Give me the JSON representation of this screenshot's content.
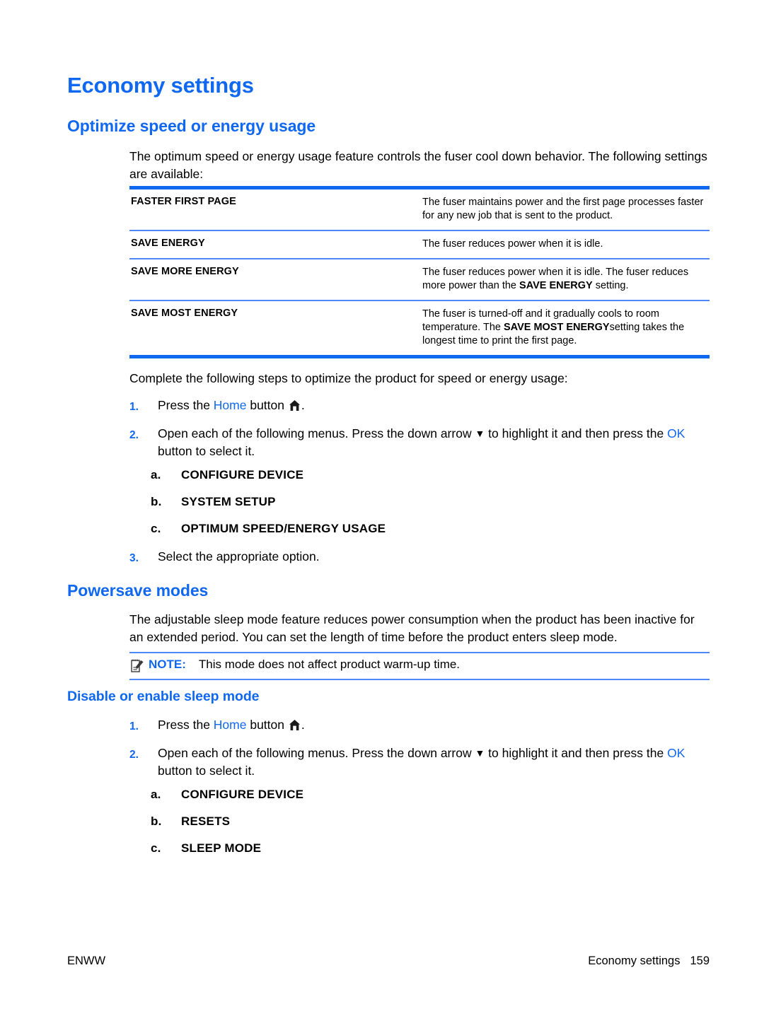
{
  "colors": {
    "accent_blue": "#1068f0",
    "rule_light_blue": "#4d86f7",
    "text": "#000000"
  },
  "page": {
    "title": "Economy settings",
    "sections": {
      "optimize": {
        "heading": "Optimize speed or energy usage",
        "intro": "The optimum speed or energy usage feature controls the fuser cool down behavior. The following settings are available:",
        "table": {
          "rows": [
            {
              "term": "FASTER FIRST PAGE",
              "desc": "The fuser maintains power and the first page processes faster for any new job that is sent to the product."
            },
            {
              "term": "SAVE ENERGY",
              "desc": "The fuser reduces power when it is idle."
            },
            {
              "term": "SAVE MORE ENERGY",
              "desc_pre": "The fuser reduces power when it is idle. The fuser reduces more power than the ",
              "desc_bold": "SAVE ENERGY",
              "desc_post": " setting."
            },
            {
              "term": "SAVE MOST ENERGY",
              "desc_pre": "The fuser is turned-off and it gradually cools to room temperature. The ",
              "desc_bold": "SAVE MOST ENERGY",
              "desc_post": "setting takes the longest time to print the first page."
            }
          ]
        },
        "complete_intro": "Complete the following steps to optimize the product for speed or energy usage:",
        "steps": {
          "s1_num": "1.",
          "s1_pre": "Press the ",
          "s1_link": "Home",
          "s1_mid": " button ",
          "s1_post": ".",
          "s2_num": "2.",
          "s2_pre": "Open each of the following menus. Press the down arrow ",
          "s2_arrow": "▼",
          "s2_mid": " to highlight it and then press the ",
          "s2_link": "OK",
          "s2_post": " button to select it.",
          "s3_num": "3.",
          "s3_text": "Select the appropriate option.",
          "sub": [
            {
              "letter": "a.",
              "label": "CONFIGURE DEVICE"
            },
            {
              "letter": "b.",
              "label": "SYSTEM SETUP"
            },
            {
              "letter": "c.",
              "label": "OPTIMUM SPEED/ENERGY USAGE"
            }
          ]
        }
      },
      "powersave": {
        "heading": "Powersave modes",
        "intro": "The adjustable sleep mode feature reduces power consumption when the product has been inactive for an extended period. You can set the length of time before the product enters sleep mode.",
        "note": {
          "label": "NOTE:",
          "text": "This mode does not affect product warm-up time."
        },
        "subheading": "Disable or enable sleep mode",
        "steps": {
          "s1_num": "1.",
          "s1_pre": "Press the ",
          "s1_link": "Home",
          "s1_mid": " button ",
          "s1_post": ".",
          "s2_num": "2.",
          "s2_pre": "Open each of the following menus. Press the down arrow ",
          "s2_arrow": "▼",
          "s2_mid": " to highlight it and then press the ",
          "s2_link": "OK",
          "s2_post": " button to select it.",
          "sub": [
            {
              "letter": "a.",
              "label": "CONFIGURE DEVICE"
            },
            {
              "letter": "b.",
              "label": "RESETS"
            },
            {
              "letter": "c.",
              "label": "SLEEP MODE"
            }
          ]
        }
      }
    }
  },
  "footer": {
    "left": "ENWW",
    "section": "Economy settings",
    "page_number": "159"
  },
  "icons": {
    "home": "home-icon",
    "note": "note-pencil-icon",
    "arrow_down": "triangle-down-icon"
  }
}
